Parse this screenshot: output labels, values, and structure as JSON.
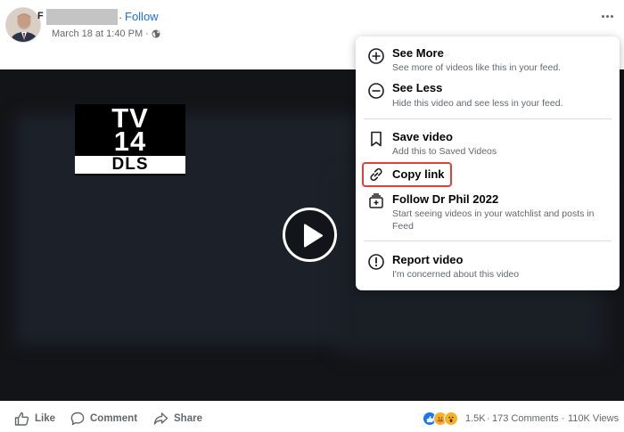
{
  "post": {
    "follow_label": "Follow",
    "follow_separator": "·",
    "timestamp": "March 18 at 1:40 PM",
    "meta_separator": "·",
    "name_initial": "F"
  },
  "video": {
    "rating": {
      "line1": "TV",
      "line2": "14",
      "line3": "DLS"
    }
  },
  "menu": {
    "items": [
      {
        "title": "See More",
        "desc": "See more of videos like this in your feed.",
        "icon": "plus-circle-icon"
      },
      {
        "title": "See Less",
        "desc": "Hide this video and see less in your feed.",
        "icon": "minus-circle-icon"
      },
      {
        "title": "Save video",
        "desc": "Add this to Saved Videos",
        "icon": "bookmark-icon"
      },
      {
        "title": "Copy link",
        "desc": "",
        "icon": "link-icon"
      },
      {
        "title": "Follow Dr Phil 2022",
        "desc": "Start seeing videos in your watchlist and posts in Feed",
        "icon": "follow-add-icon"
      },
      {
        "title": "Report video",
        "desc": "I'm concerned about this video",
        "icon": "report-icon"
      }
    ],
    "highlight_color": "#e0403a"
  },
  "footer": {
    "like_label": "Like",
    "comment_label": "Comment",
    "share_label": "Share",
    "reaction_count": "1.5K",
    "comments": "173 Comments",
    "views": "110K Views",
    "stat_separator": "·"
  },
  "colors": {
    "link_blue": "#216fdb",
    "muted_text": "#65676b",
    "like_blue": "#1877f2"
  }
}
